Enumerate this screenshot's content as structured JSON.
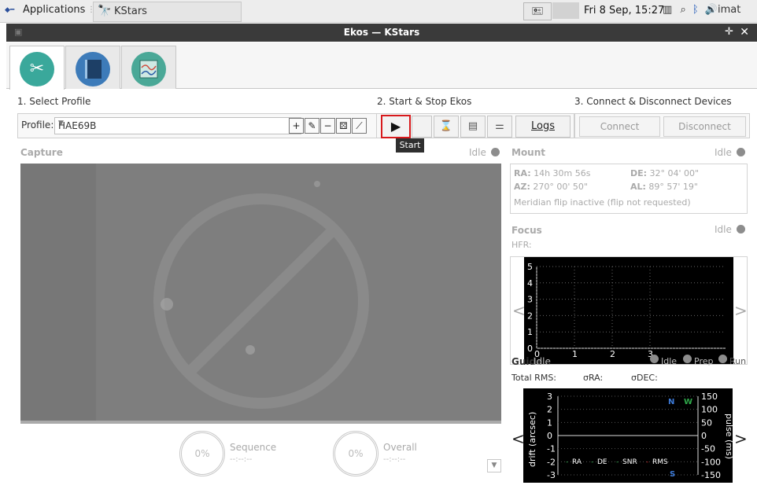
{
  "panel": {
    "applications_label": "Applications",
    "task_label": "KStars",
    "clock": "Fri  8 Sep, 15:27",
    "user": "imat",
    "tray_button_glyph": "🖭"
  },
  "window": {
    "title": "Ekos — KStars"
  },
  "tabs": [
    {
      "icon": "wrench-screwdriver-icon",
      "color": "#3aa89b"
    },
    {
      "icon": "notebook-icon",
      "color": "#3d7bb9"
    },
    {
      "icon": "analyze-chart-icon",
      "color": "#4aa897"
    }
  ],
  "sections": {
    "profile": "1. Select Profile",
    "startstop": "2. Start & Stop Ekos",
    "connect": "3. Connect & Disconnect Devices"
  },
  "profile": {
    "label": "Profile:",
    "value": "HAE69B"
  },
  "controls": {
    "logs": "Logs",
    "connect": "Connect",
    "disconnect": "Disconnect",
    "tooltip": "Start"
  },
  "capture": {
    "title": "Capture",
    "status": "Idle",
    "sequence_label": "Sequence",
    "sequence_pct": "0%",
    "sequence_time": "--:--:--",
    "overall_label": "Overall",
    "overall_pct": "0%",
    "overall_time": "--:--:--"
  },
  "mount": {
    "title": "Mount",
    "status": "Idle",
    "ra_key": "RA:",
    "ra": "14h 30m 56s",
    "de_key": "DE:",
    "de": "32° 04' 00\"",
    "az_key": "AZ:",
    "az": "270° 00' 50\"",
    "al_key": "AL:",
    "al": "89° 57' 19\"",
    "meridian": "Meridian flip inactive (flip not requested)"
  },
  "focus": {
    "title": "Focus",
    "status": "Idle",
    "hfr": "HFR:",
    "y_ticks": [
      "5",
      "4",
      "3",
      "2",
      "1",
      "0"
    ],
    "x_ticks": [
      "0",
      "1",
      "2",
      "3"
    ]
  },
  "guide": {
    "title": "Guide",
    "status": "Idle",
    "states": [
      "Idle",
      "Prep",
      "Run"
    ],
    "rms": "Total RMS:",
    "sigma_ra": "σRA:",
    "sigma_dec": "σDEC:",
    "left_axis": "drift (arcsec)",
    "right_axis": "pulse (ms)",
    "left_ticks": [
      "3",
      "2",
      "1",
      "0",
      "-1",
      "-2",
      "-3"
    ],
    "right_ticks": [
      "150",
      "100",
      "50",
      "0",
      "-50",
      "-100",
      "-150"
    ],
    "legend": [
      "RA",
      "DE",
      "SNR",
      "RMS"
    ],
    "compass_n": "N",
    "compass_w": "W",
    "compass_s": "S"
  }
}
